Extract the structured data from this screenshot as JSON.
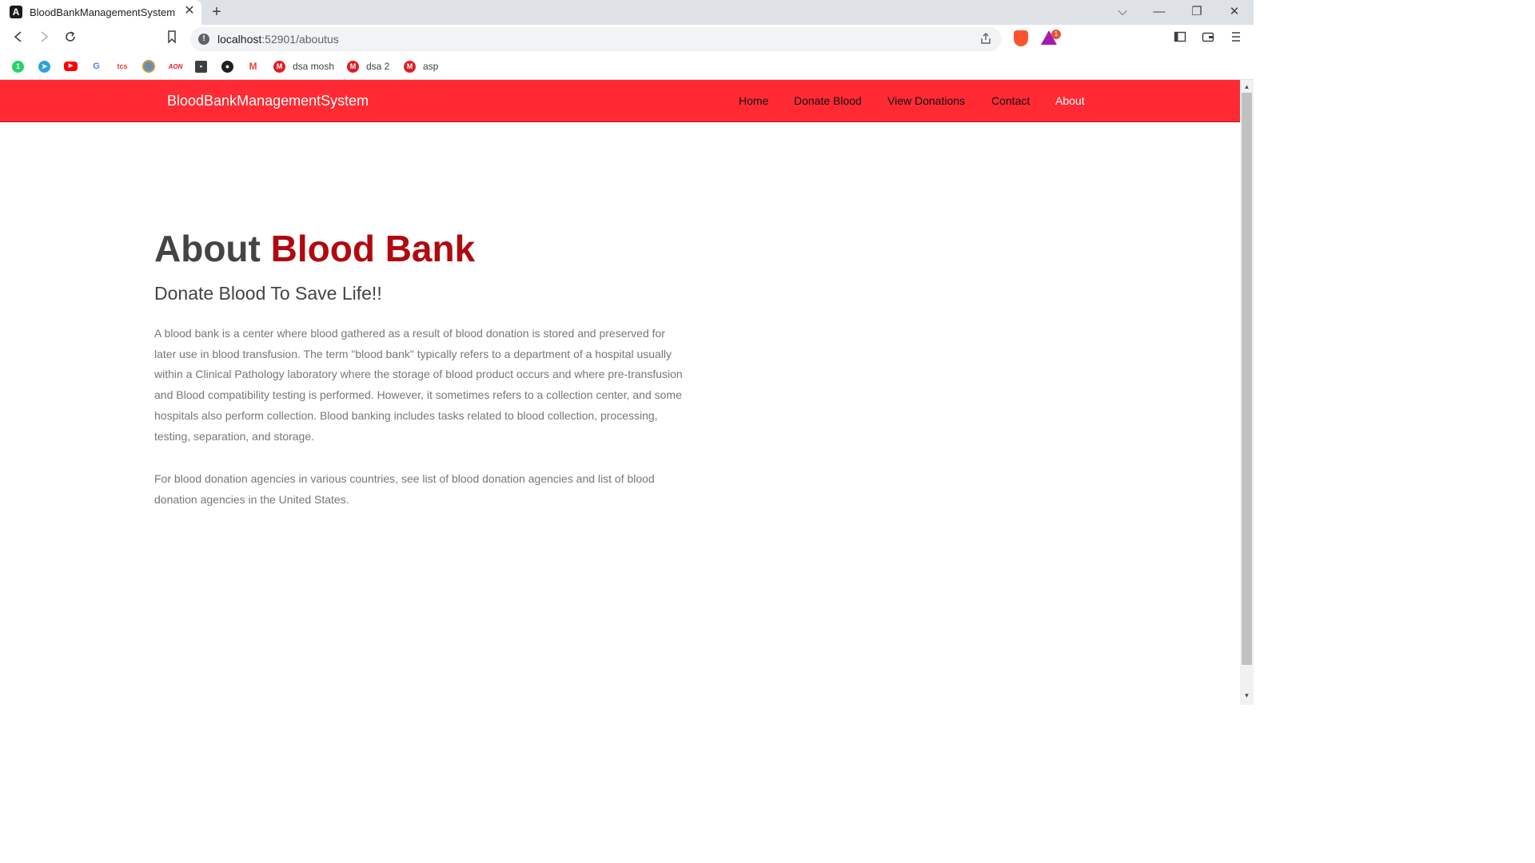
{
  "browser": {
    "tab_title": "BloodBankManagementSystem",
    "favicon_letter": "A",
    "close_glyph": "✕",
    "newtab_glyph": "+",
    "url_host": "localhost",
    "url_path": ":52901/aboutus",
    "window_controls": [
      "⌵",
      "—",
      "❐",
      "✕"
    ],
    "rewards_badge": "1",
    "bookmarks": [
      {
        "icon": "whatsapp-icon",
        "label": "",
        "color": "#25d366"
      },
      {
        "icon": "telegram-icon",
        "label": "",
        "color": "#2aa3e0"
      },
      {
        "icon": "youtube-icon",
        "label": "",
        "color": "#ff0000"
      },
      {
        "icon": "google-icon",
        "label": "",
        "color": "#4285f4"
      },
      {
        "icon": "tcs-icon",
        "label": "",
        "color": "#e53935"
      },
      {
        "icon": "emblem-icon",
        "label": "",
        "color": "#6b8fb3"
      },
      {
        "icon": "aon-icon",
        "label": "",
        "color": "#e01e26"
      },
      {
        "icon": "contact-card-icon",
        "label": "",
        "color": "#3c4043"
      },
      {
        "icon": "github-icon",
        "label": "",
        "color": "#1f1f1f"
      },
      {
        "icon": "gmail-icon",
        "label": "",
        "color": "#ea4335"
      },
      {
        "icon": "mosh-icon",
        "label": "dsa mosh",
        "color": "#e31b23"
      },
      {
        "icon": "mosh-icon",
        "label": "dsa 2",
        "color": "#e31b23"
      },
      {
        "icon": "mosh-icon",
        "label": "asp",
        "color": "#e31b23"
      }
    ]
  },
  "navbar": {
    "brand": "BloodBankManagementSystem",
    "links": [
      "Home",
      "Donate Blood",
      "View Donations",
      "Contact",
      "About"
    ],
    "active": "About",
    "color": "#ff2a33"
  },
  "content": {
    "title_prefix": "About",
    "title_highlight": "Blood Bank",
    "subtitle": "Donate Blood To Save Life!!",
    "paragraphs": [
      "A blood bank is a center where blood gathered as a result of blood donation is stored and preserved for later use in blood transfusion. The term \"blood bank\" typically refers to a department of a hospital usually within a Clinical Pathology laboratory where the storage of blood product occurs and where pre-transfusion and Blood compatibility testing is performed. However, it sometimes refers to a collection center, and some hospitals also perform collection. Blood banking includes tasks related to blood collection, processing, testing, separation, and storage.",
      "For blood donation agencies in various countries, see list of blood donation agencies and list of blood donation agencies in the United States."
    ],
    "highlight_color": "#b0090f"
  }
}
